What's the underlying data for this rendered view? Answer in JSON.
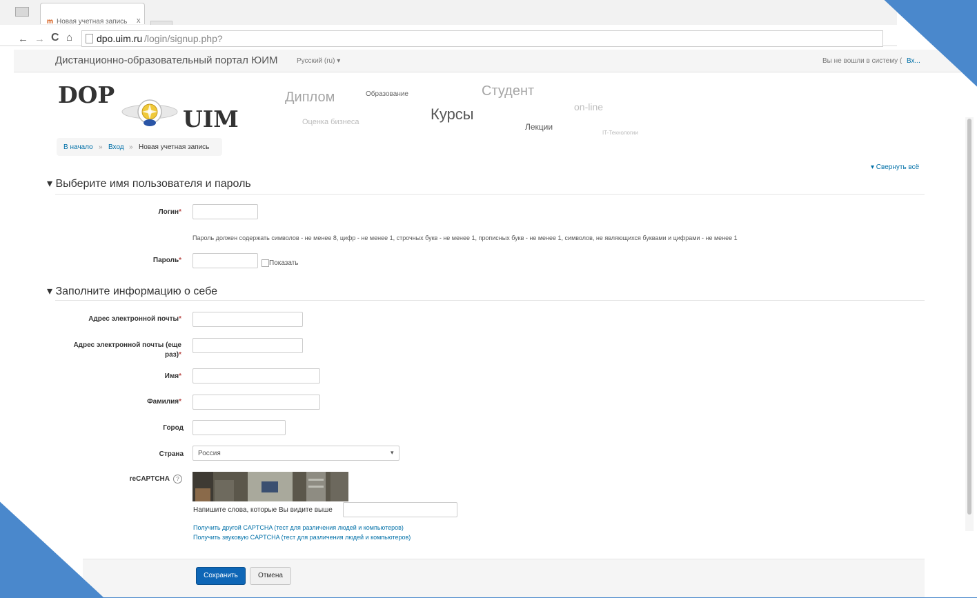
{
  "browser": {
    "tab_title": "Новая учетная запись",
    "tab_favicon_text": "m",
    "tab_close": "x",
    "nav_back": "←",
    "nav_forward": "→",
    "nav_reload": "C",
    "nav_home": "⌂",
    "url_host": "dpo.uim.ru",
    "url_path": "/login/signup.php?"
  },
  "site": {
    "brand": "Дистанционно-образовательный портал ЮИМ",
    "language": "Русский (ru) ▾",
    "login_status": "Вы не вошли в систему (",
    "login_link": "Вх..."
  },
  "logo": {
    "top": "DOP",
    "bottom": "UIM"
  },
  "tag_cloud": [
    "Диплом",
    "Образование",
    "Студент",
    "on-line",
    "Оценка бизнеса",
    "Курсы",
    "Лекции",
    "IT-Технологии"
  ],
  "breadcrumb": {
    "home": "В начало",
    "sep": "»",
    "login": "Вход",
    "current": "Новая учетная запись"
  },
  "collapse_all": "▾ Свернуть всё",
  "section1": {
    "title": "▾ Выберите имя пользователя и пароль",
    "username_label": "Логин",
    "password_policy": "Пароль должен содержать символов - не менее 8, цифр - не менее 1, строчных букв - не менее 1, прописных букв - не менее 1, символов, не являющихся буквами и цифрами - не менее 1",
    "password_label": "Пароль",
    "show_label": "Показать"
  },
  "section2": {
    "title": "▾ Заполните информацию о себе",
    "email_label": "Адрес электронной почты",
    "email2_label": "Адрес электронной почты (еще раз)",
    "firstname_label": "Имя",
    "lastname_label": "Фамилия",
    "city_label": "Город",
    "country_label": "Страна",
    "country_value": "Россия",
    "recaptcha_label": "reCAPTCHA",
    "captcha_prompt": "Напишите слова, которые Вы видите выше",
    "captcha_link_other": "Получить другой CAPTCHA (тест для различения людей и компьютеров)",
    "captcha_link_audio": "Получить звуковую CAPTCHA (тест для различения людей и компьютеров)"
  },
  "required_mark": "*",
  "buttons": {
    "save": "Сохранить",
    "cancel": "Отмена"
  },
  "colors": {
    "frame": "#4a88cc",
    "primary_button": "#0e66b6",
    "link": "#0070a8",
    "required": "#b94a48"
  }
}
